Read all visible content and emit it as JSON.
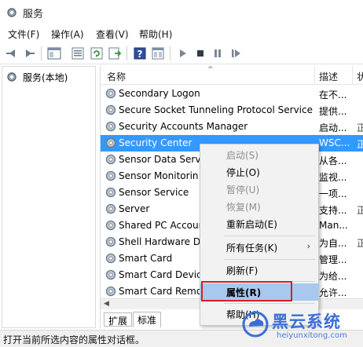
{
  "window": {
    "title": "服务"
  },
  "menu": [
    "文件(F)",
    "操作(A)",
    "查看(V)",
    "帮助(H)"
  ],
  "tree": {
    "root_label": "服务(本地)"
  },
  "columns": {
    "name": "名称",
    "desc": "描述",
    "status": "状"
  },
  "services": [
    {
      "name": "Secondary Logon",
      "desc": "在不...",
      "status": ""
    },
    {
      "name": "Secure Socket Tunneling Protocol Service",
      "desc": "提供...",
      "status": ""
    },
    {
      "name": "Security Accounts Manager",
      "desc": "启动...",
      "status": "正"
    },
    {
      "name": "Security Center",
      "desc": "WSC...",
      "status": "正",
      "selected": true
    },
    {
      "name": "Sensor Data Serv",
      "desc": "从各...",
      "status": ""
    },
    {
      "name": "Sensor Monitorin",
      "desc": "监视...",
      "status": ""
    },
    {
      "name": "Sensor Service",
      "desc": "一项...",
      "status": ""
    },
    {
      "name": "Server",
      "desc": "支持...",
      "status": "正"
    },
    {
      "name": "Shared PC Accour",
      "desc": "Man...",
      "status": ""
    },
    {
      "name": "Shell Hardware D",
      "desc": "为自...",
      "status": "正"
    },
    {
      "name": "Smart Card",
      "desc": "管理...",
      "status": ""
    },
    {
      "name": "Smart Card Devic",
      "desc": "为给...",
      "status": ""
    },
    {
      "name": "Smart Card Remo",
      "desc": "允许...",
      "status": ""
    }
  ],
  "tabs": [
    "扩展",
    "标准"
  ],
  "context_menu": {
    "start": "启动(S)",
    "stop": "停止(O)",
    "pause": "暂停(U)",
    "resume": "恢复(M)",
    "restart": "重新启动(E)",
    "all_tasks": "所有任务(K)",
    "refresh": "刷新(F)",
    "properties": "属性(R)",
    "help": "帮助(H)"
  },
  "status_text": "打开当前所选内容的属性对话框。",
  "watermark": {
    "title": "黑云系统",
    "url": "heiyunxitong.com"
  },
  "colors": {
    "selection": "#3399ff",
    "menu_highlight": "#a8c8f0",
    "callout": "#d62020",
    "watermark": "#3b6fd6"
  }
}
